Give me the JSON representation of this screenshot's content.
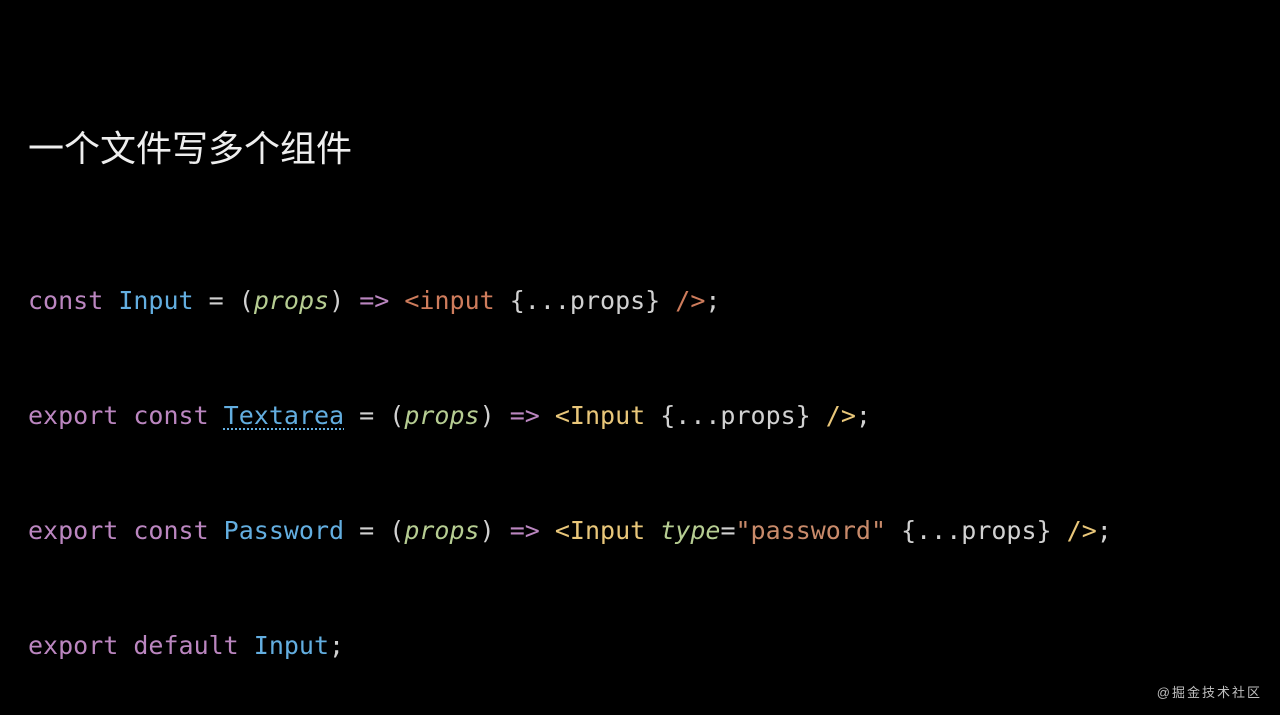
{
  "title": "一个文件写多个组件",
  "watermark": "@掘金技术社区",
  "code": {
    "line1": {
      "kw_const": "const",
      "name": "Input",
      "eq": " = ",
      "lp": "(",
      "param": "props",
      "rp": ")",
      "arrow": " => ",
      "jsx_open": "<input ",
      "spread": "{...props}",
      "jsx_close": " />",
      "semi": ";"
    },
    "line2": {
      "kw_export": "export",
      "kw_const": " const ",
      "name": "Textarea",
      "eq": " = ",
      "lp": "(",
      "param": "props",
      "rp": ")",
      "arrow": " => ",
      "jsx_open": "<Input ",
      "spread": "{...props}",
      "jsx_close": " />",
      "semi": ";"
    },
    "line3": {
      "kw_export": "export",
      "kw_const": " const ",
      "name": "Password",
      "eq": " = ",
      "lp": "(",
      "param": "props",
      "rp": ")",
      "arrow": " => ",
      "jsx_open": "<Input ",
      "attr_name": "type",
      "attr_eq": "=",
      "attr_val": "\"password\"",
      "sp": " ",
      "spread": "{...props}",
      "jsx_close": " />",
      "semi": ";"
    },
    "line4": {
      "kw_export": "export",
      "kw_default": " default ",
      "name": "Input",
      "semi": ";"
    }
  }
}
